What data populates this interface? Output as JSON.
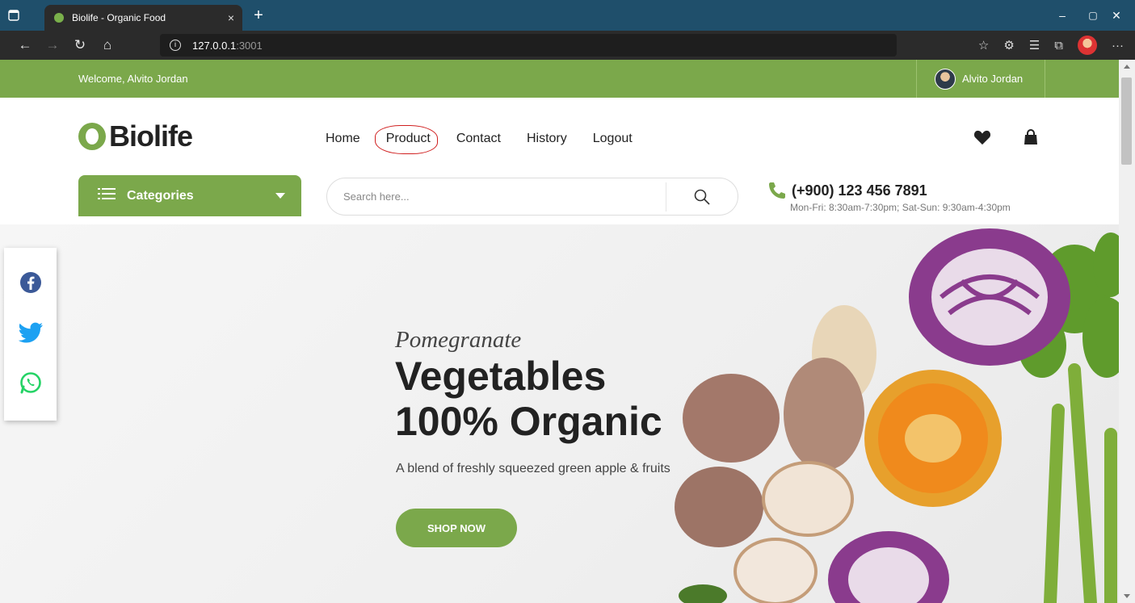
{
  "browser": {
    "tab_title": "Biolife - Organic Food",
    "tab_close": "×",
    "new_tab": "+",
    "url_host": "127.0.0.1",
    "url_port": ":3001",
    "window": {
      "minimize": "–",
      "restore": "▢",
      "close": "✕"
    }
  },
  "topbar": {
    "welcome": "Welcome, Alvito Jordan",
    "user_name": "Alvito Jordan",
    "color": "#7ba84b"
  },
  "header": {
    "brand": "Biolife",
    "nav": [
      "Home",
      "Product",
      "Contact",
      "History",
      "Logout"
    ],
    "active_nav": "Product"
  },
  "categories": {
    "label": "Categories"
  },
  "search": {
    "placeholder": "Search here..."
  },
  "contact": {
    "phone": "(+900) 123 456 7891",
    "hours": "Mon-Fri: 8:30am-7:30pm; Sat-Sun: 9:30am-4:30pm"
  },
  "hero": {
    "kicker": "Pomegranate",
    "title_line1": "Vegetables",
    "title_line2": "100% Organic",
    "subtitle": "A blend of freshly squeezed green apple & fruits",
    "cta": "SHOP NOW"
  },
  "social": [
    "facebook-icon",
    "twitter-icon",
    "whatsapp-icon"
  ]
}
